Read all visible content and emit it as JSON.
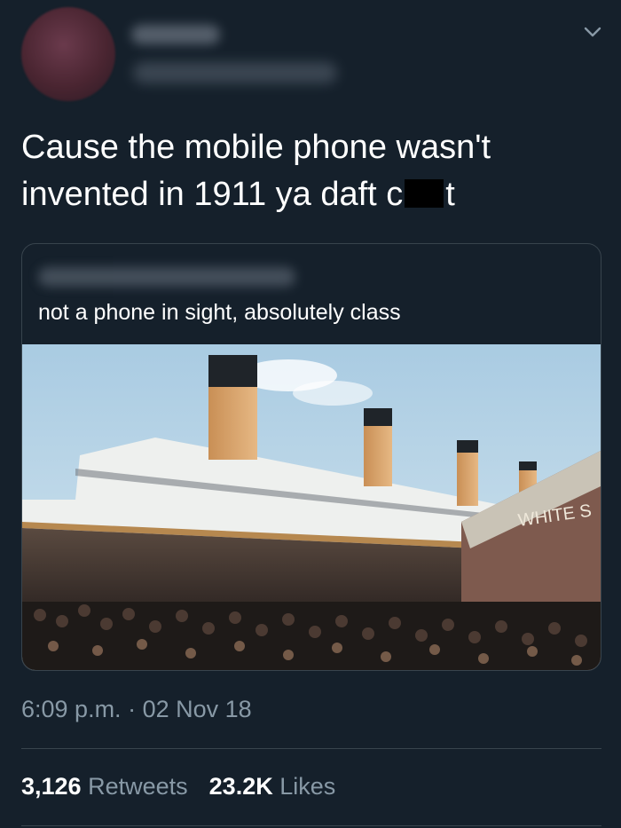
{
  "tweet": {
    "text_line1": "Cause the mobile phone wasn't",
    "text_line2_before": "invented in 1911 ya daft c",
    "text_line2_after": "t",
    "menu_icon": "chevron-down-icon"
  },
  "quote": {
    "text": "not a phone in sight, absolutely class",
    "media_sign": "WHITE S"
  },
  "meta": {
    "time": "6:09 p.m.",
    "separator": "·",
    "date": "02 Nov 18"
  },
  "stats": {
    "retweets_count": "3,126",
    "retweets_label": "Retweets",
    "likes_count": "23.2K",
    "likes_label": "Likes"
  },
  "colors": {
    "background": "#15202b",
    "secondary_text": "#8899a6",
    "border": "#38444d"
  }
}
